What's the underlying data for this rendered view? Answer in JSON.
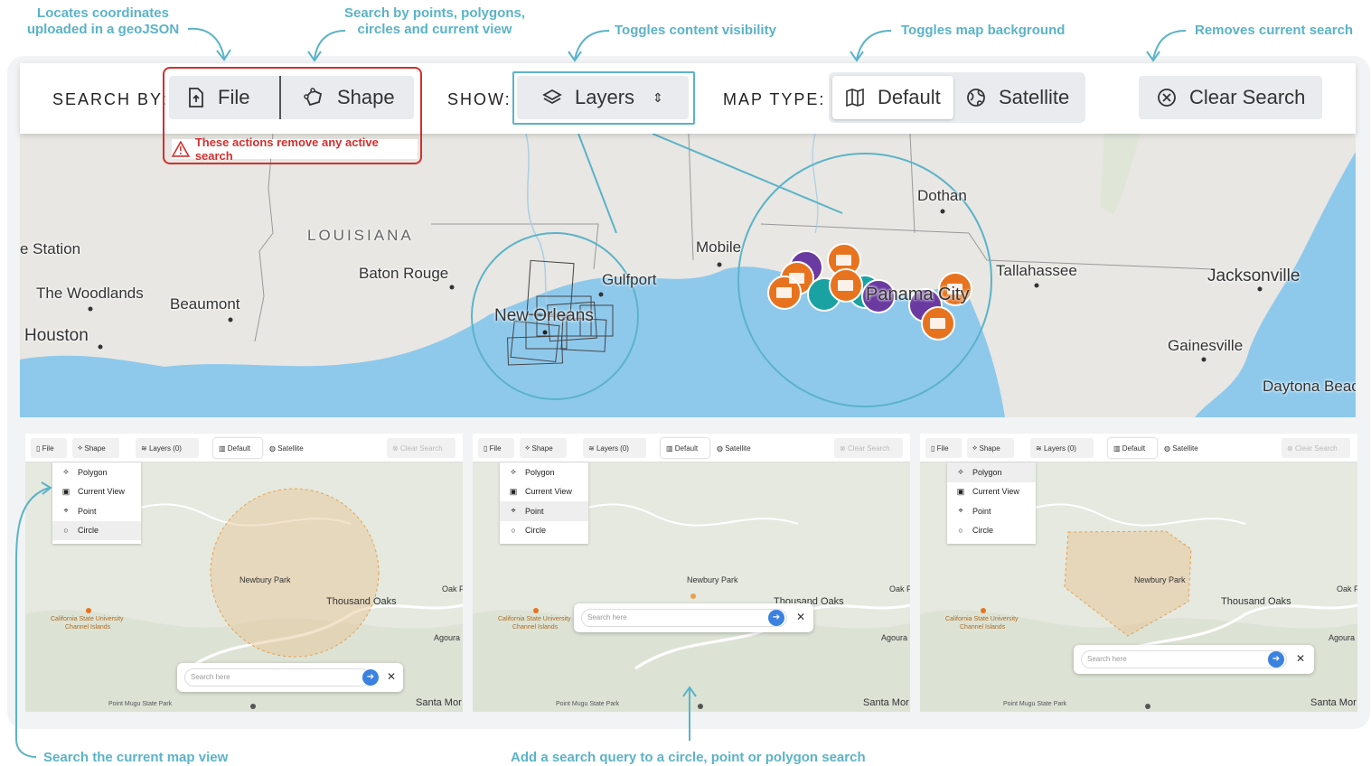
{
  "annotations": {
    "geojson": "Locates coordinates uploaded in a geoJSON",
    "search_by": "Search by points, polygons, circles and current view",
    "visibility": "Toggles content visibility",
    "map_bg": "Toggles map background",
    "remove": "Removes current search",
    "current_view": "Search the current map view",
    "query": "Add a search query to a circle, point or polygon search"
  },
  "toolbar": {
    "search_by_label": "SEARCH BY:",
    "file_label": "File",
    "shape_label": "Shape",
    "warning": "These actions remove any active search",
    "show_label": "SHOW:",
    "layers_label": "Layers",
    "map_type_label": "MAP TYPE:",
    "default_label": "Default",
    "satellite_label": "Satellite",
    "clear_label": "Clear Search"
  },
  "map_labels": {
    "station": "e Station",
    "woodlands": "The Woodlands",
    "houston": "Houston",
    "beaumont": "Beaumont",
    "louisiana": "LOUISIANA",
    "baton_rouge": "Baton Rouge",
    "new_orleans": "New Orleans",
    "gulfport": "Gulfport",
    "mobile": "Mobile",
    "dothan": "Dothan",
    "panama_city": "Panama City",
    "tallahassee": "Tallahassee",
    "jacksonville": "Jacksonville",
    "gainesville": "Gainesville",
    "daytona": "Daytona Beac"
  },
  "small_toolbar": {
    "file": "File",
    "shape": "Shape",
    "layers": "Layers (0)",
    "default": "Default",
    "satellite": "Satellite",
    "clear": "Clear Search"
  },
  "dropdown": {
    "polygon": "Polygon",
    "current_view": "Current View",
    "point": "Point",
    "circle": "Circle"
  },
  "small_map": {
    "newbury": "Newbury Park",
    "thousand": "Thousand Oaks",
    "thousand_partial": "Thousand Oaks",
    "oak": "Oak P",
    "csu1": "California State University",
    "csu2": "Channel Islands",
    "agoura": "Agoura I",
    "mugu": "Point Mugu State Park",
    "santa": "Santa Mor",
    "search_placeholder": "Search here"
  },
  "colors": {
    "accent": "#5bb3c8",
    "warning": "#d32f2f",
    "orange": "#e8731f",
    "purple": "#6a3aa0",
    "teal": "#1aa2a2",
    "water": "#8ec9ec"
  }
}
